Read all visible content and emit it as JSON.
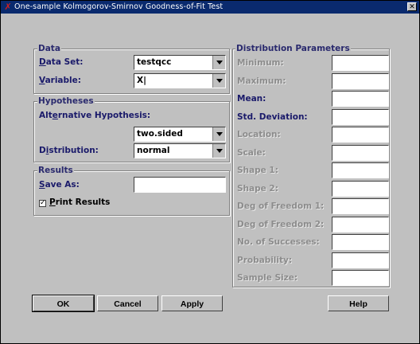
{
  "window": {
    "title": "One-sample Kolmogorov-Smirnov Goodness-of-Fit Test",
    "close_glyph": "✕",
    "app_icon_glyph": "✗"
  },
  "data": {
    "legend": "Data",
    "data_set_label": "Data Set:",
    "data_set_value": "testqcc",
    "variable_label": "Variable:",
    "variable_value": "X|"
  },
  "hypotheses": {
    "legend": "Hypotheses",
    "alt_label": "Alternative Hypothesis:",
    "alt_value": "two.sided",
    "distribution_label": "Distribution:",
    "distribution_value": "normal"
  },
  "results": {
    "legend": "Results",
    "save_as_label": "Save As:",
    "save_as_value": "",
    "print_results_label": "Print Results",
    "print_results_checked": true,
    "check_glyph": "✓"
  },
  "params": {
    "legend": "Distribution Parameters",
    "items": [
      {
        "label": "Minimum:",
        "value": "",
        "enabled": false
      },
      {
        "label": "Maximum:",
        "value": "",
        "enabled": false
      },
      {
        "label": "Mean:",
        "value": "",
        "enabled": true
      },
      {
        "label": "Std. Deviation:",
        "value": "",
        "enabled": true
      },
      {
        "label": "Location:",
        "value": "",
        "enabled": false
      },
      {
        "label": "Scale:",
        "value": "",
        "enabled": false
      },
      {
        "label": "Shape 1:",
        "value": "",
        "enabled": false
      },
      {
        "label": "Shape 2:",
        "value": "",
        "enabled": false
      },
      {
        "label": "Deg of Freedom 1:",
        "value": "",
        "enabled": false
      },
      {
        "label": "Deg of Freedom 2:",
        "value": "",
        "enabled": false
      },
      {
        "label": "No. of Successes:",
        "value": "",
        "enabled": false
      },
      {
        "label": "Probability:",
        "value": "",
        "enabled": false
      },
      {
        "label": "Sample Size:",
        "value": "",
        "enabled": false
      }
    ]
  },
  "buttons": {
    "ok": "OK",
    "cancel": "Cancel",
    "apply": "Apply",
    "help": "Help"
  }
}
